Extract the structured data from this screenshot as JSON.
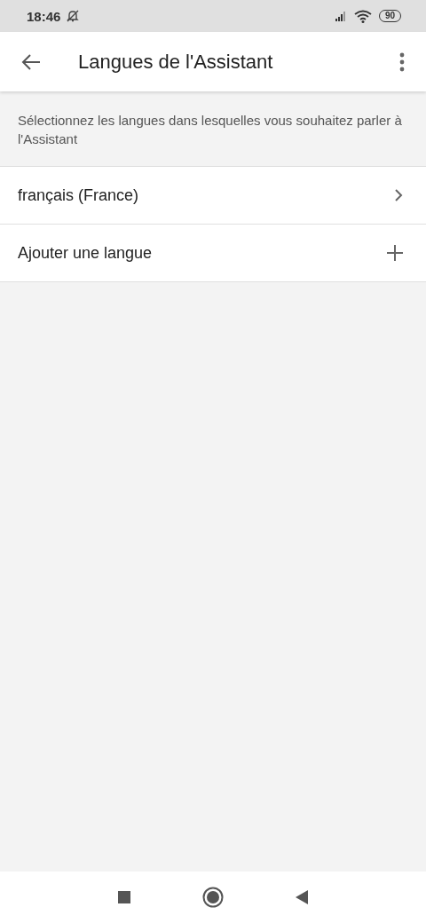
{
  "status_bar": {
    "time": "18:46",
    "battery": "90"
  },
  "app_bar": {
    "title": "Langues de l'Assistant"
  },
  "description": "Sélectionnez les langues dans lesquelles vous souhaitez parler à l'Assistant",
  "items": [
    {
      "label": "français (France)",
      "kind": "language"
    },
    {
      "label": "Ajouter une langue",
      "kind": "add"
    }
  ]
}
